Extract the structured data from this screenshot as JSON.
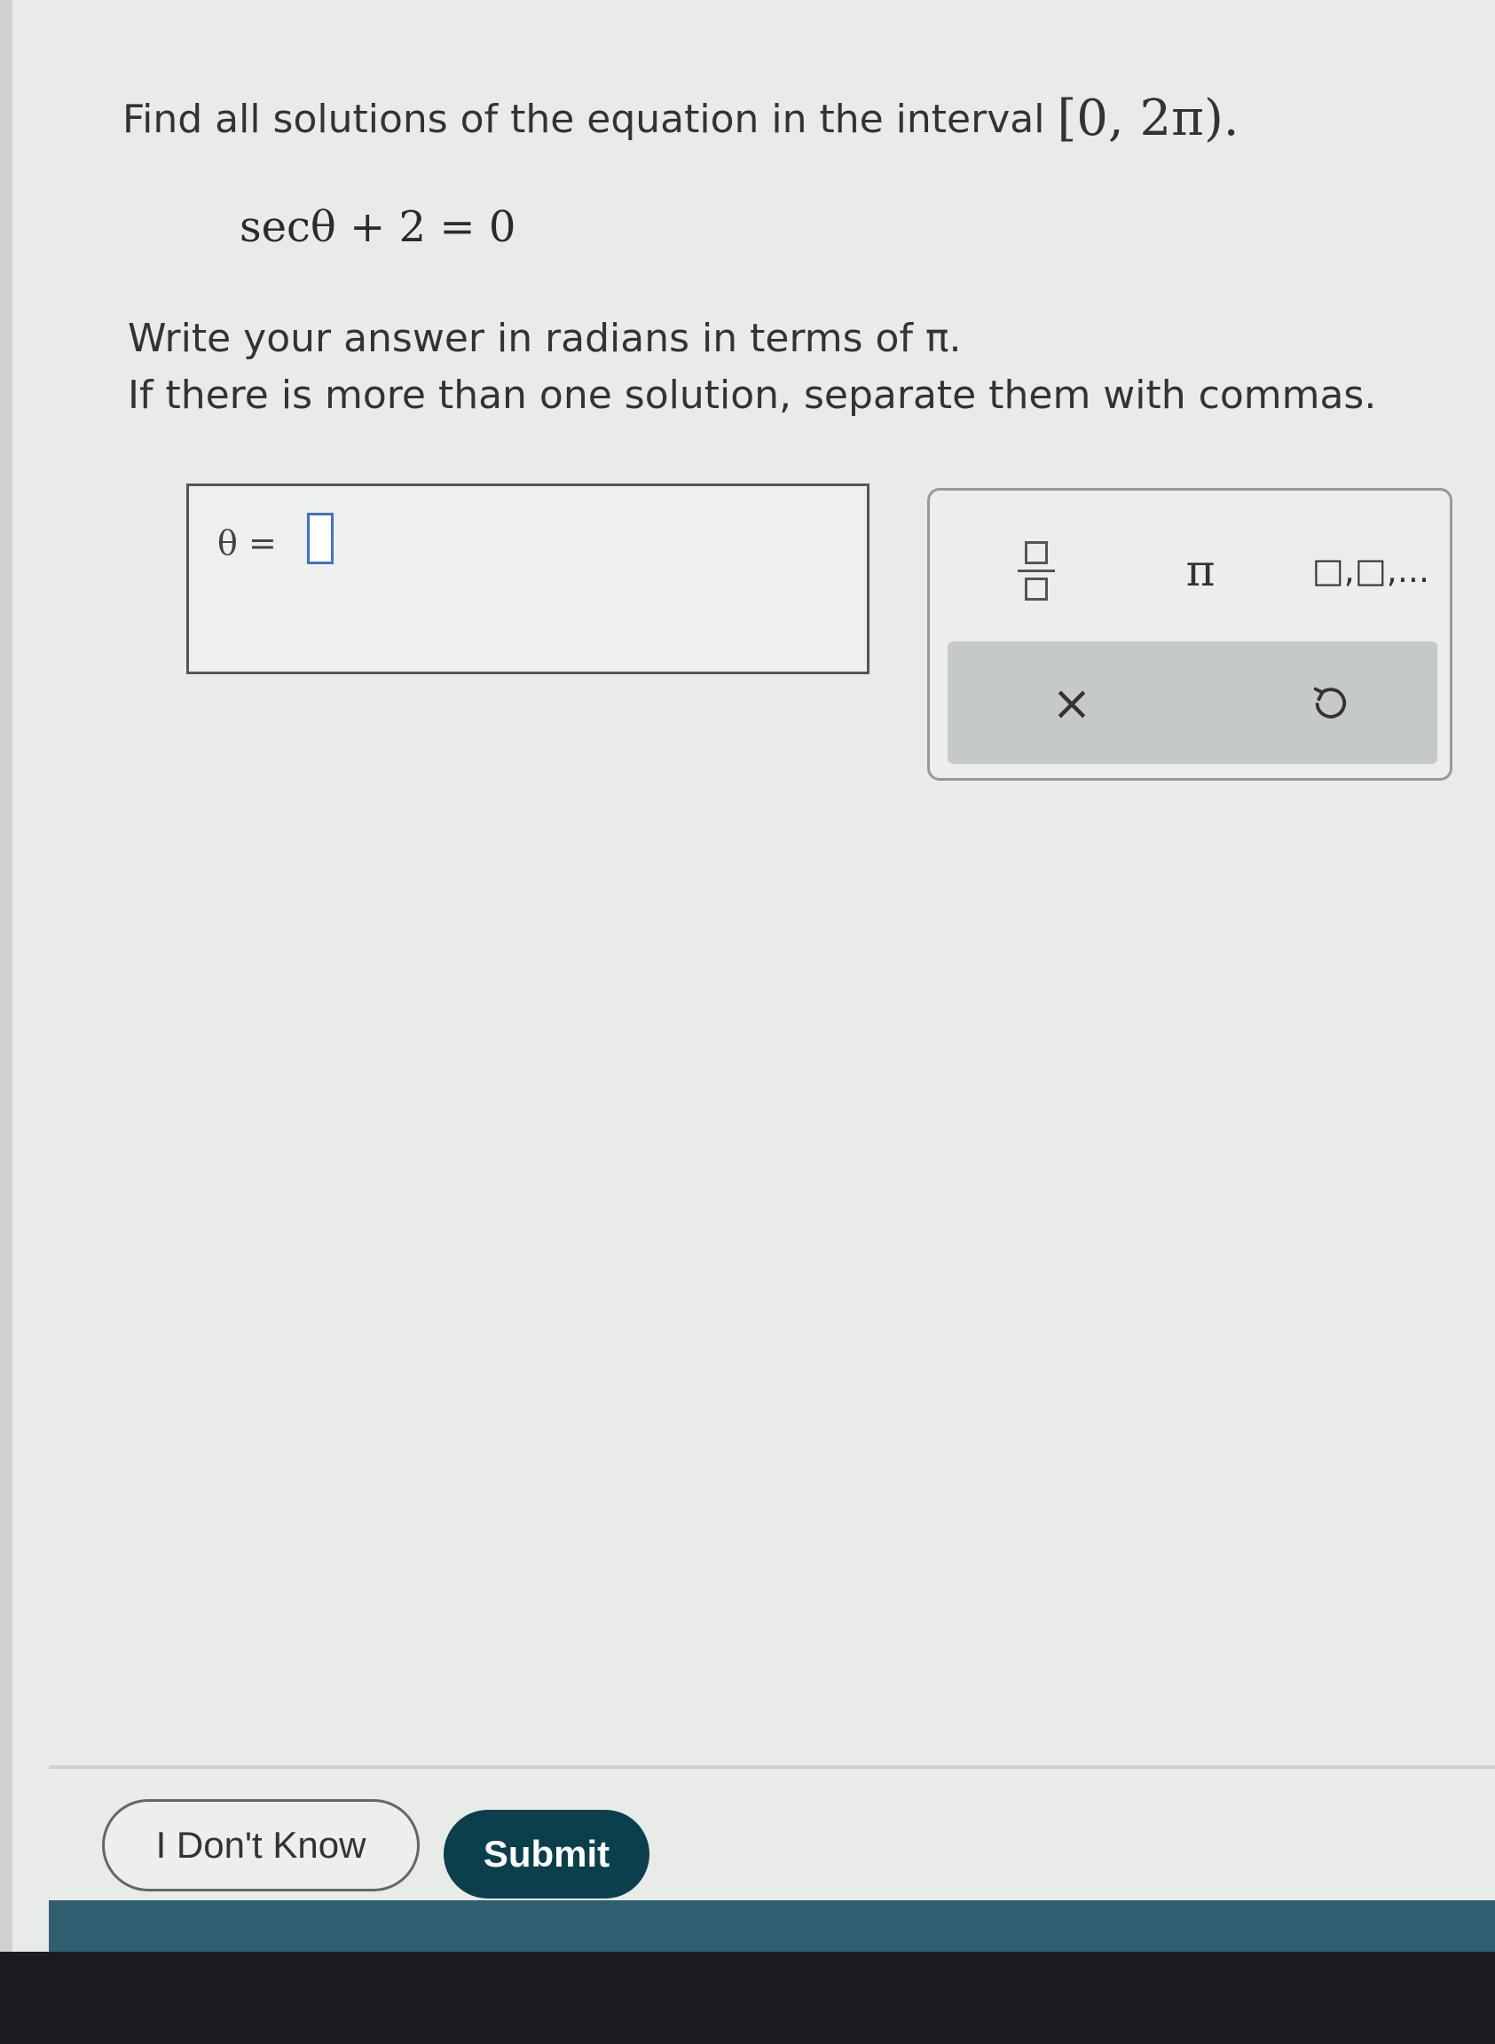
{
  "question": {
    "prompt": "Find all solutions of the equation in the interval",
    "interval": "[0, 2π).",
    "equation": "secθ + 2 = 0",
    "instruction_1": "Write your answer in radians in terms of π.",
    "instruction_2": "If there is more than one solution, separate them with commas."
  },
  "answer": {
    "label": "θ ="
  },
  "palette": {
    "fraction_icon": "fraction-icon",
    "pi_label": "π",
    "list_label": "□,□,...",
    "clear_label": "×",
    "undo_icon": "undo-icon"
  },
  "actions": {
    "dont_know_label": "I Don't Know",
    "submit_label": "Submit"
  }
}
